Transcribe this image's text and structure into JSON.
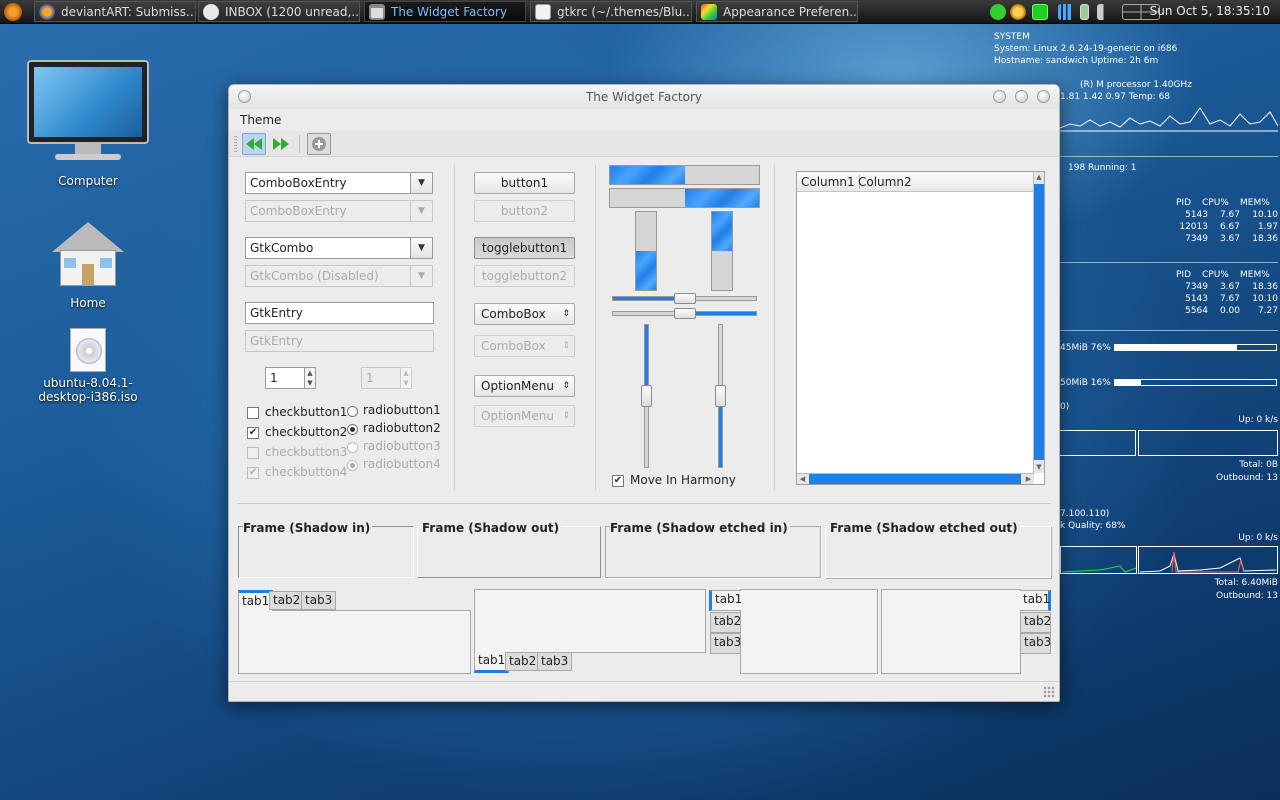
{
  "panel": {
    "tasks": [
      {
        "label": "deviantART: Submiss..."
      },
      {
        "label": "INBOX (1200 unread,..."
      },
      {
        "label": "The Widget Factory"
      },
      {
        "label": "gtkrc (~/.themes/Blu..."
      },
      {
        "label": "Appearance Preferen..."
      }
    ],
    "clock": "Sun Oct  5, 18:35:10",
    "tray_icons": [
      "network-icon",
      "search-icon",
      "mail-icon",
      "signal-icon",
      "battery-icon",
      "volume-icon",
      "workspace-icon"
    ]
  },
  "desktop": {
    "icons": [
      {
        "label": "Computer",
        "icon": "computer-icon"
      },
      {
        "label": "Home",
        "icon": "home-folder-icon"
      },
      {
        "label": "ubuntu-8.04.1-desktop-i386.iso",
        "line1": "ubuntu-8.04.1-",
        "line2": "desktop-i386.iso",
        "icon": "disc-image-icon"
      }
    ]
  },
  "conky": {
    "system_header": "SYSTEM",
    "system_line": "System: Linux 2.6.24-19-generic on i686",
    "host_line": "Hostname: sandwich    Uptime: 2h 6m",
    "cpu_line": "(R) M processor        1.40GHz",
    "load_line": "1.81 1.42 0.97  Temp: 68",
    "procs_line": "198      Running:  1",
    "cpu_table": {
      "headers": [
        "PID",
        "CPU%",
        "MEM%"
      ],
      "rows": [
        [
          "5143",
          "7.67",
          "10.10"
        ],
        [
          "12013",
          "6.67",
          "1.97"
        ],
        [
          "7349",
          "3.67",
          "18.36"
        ]
      ]
    },
    "mem_table": {
      "headers": [
        "PID",
        "CPU%",
        "MEM%"
      ],
      "rows": [
        [
          "7349",
          "3.67",
          "18.36"
        ],
        [
          "5143",
          "7.67",
          "10.10"
        ],
        [
          "5564",
          "0.00",
          "7.27"
        ]
      ]
    },
    "ram_line": "45MiB  76%",
    "ram_pct": 76,
    "swap_line": "50MiB  16%",
    "swap_pct": 16,
    "net1_head": "0)",
    "net1_up": "Up: 0 k/s",
    "net1_total": "Total: 0B",
    "net1_out": "Outbound: 13",
    "net2_head": "7.100.110)",
    "net2_quality": "k Quality: 68%",
    "net2_up": "Up: 0 k/s",
    "net2_total": "Total: 6.40MiB",
    "net2_out": "Outbound: 13"
  },
  "window": {
    "title": "The Widget Factory",
    "menu": "Theme",
    "toolbar": [
      "back-icon",
      "forward-icon",
      "add-icon"
    ],
    "col1": {
      "combo_entry": "ComboBoxEntry",
      "combo_entry_dis": "ComboBoxEntry",
      "gtk_combo": "GtkCombo",
      "gtk_combo_dis": "GtkCombo (Disabled)",
      "entry": "GtkEntry",
      "entry_dis": "GtkEntry",
      "spin": "1",
      "spin_dis": "1",
      "checks": [
        {
          "label": "checkbutton1",
          "checked": false,
          "disabled": false
        },
        {
          "label": "checkbutton2",
          "checked": true,
          "disabled": false
        },
        {
          "label": "checkbutton3",
          "checked": false,
          "disabled": true
        },
        {
          "label": "checkbutton4",
          "checked": true,
          "disabled": true
        }
      ],
      "radios": [
        {
          "label": "radiobutton1",
          "checked": false,
          "disabled": false
        },
        {
          "label": "radiobutton2",
          "checked": true,
          "disabled": false
        },
        {
          "label": "radiobutton3",
          "checked": false,
          "disabled": true
        },
        {
          "label": "radiobutton4",
          "checked": true,
          "disabled": true
        }
      ]
    },
    "col2": {
      "button1": "button1",
      "button2": "button2",
      "toggle1": "togglebutton1",
      "toggle2": "togglebutton2",
      "combobox": "ComboBox",
      "combobox_dis": "ComboBox",
      "optionmenu": "OptionMenu",
      "optionmenu_dis": "OptionMenu"
    },
    "col3": {
      "progress_h1": 0.5,
      "progress_h2": 0.5,
      "progress_v1": 0.5,
      "progress_v2": 0.5,
      "hscale1": 0.5,
      "hscale2": 0.5,
      "vscale1": 0.5,
      "vscale2": 0.5,
      "harmony_label": "Move In Harmony",
      "harmony_checked": true
    },
    "tree": {
      "columns": [
        "Column1",
        "Column2"
      ]
    },
    "frames": [
      "Frame (Shadow in)",
      "Frame (Shadow out)",
      "Frame (Shadow etched in)",
      "Frame (Shadow etched out)"
    ],
    "notebooks": {
      "tabs": [
        "tab1",
        "tab2",
        "tab3"
      ]
    }
  },
  "colors": {
    "accent": "#1f7fe6",
    "window_bg": "#ececec",
    "panel_bg": "#1e1e1e"
  }
}
